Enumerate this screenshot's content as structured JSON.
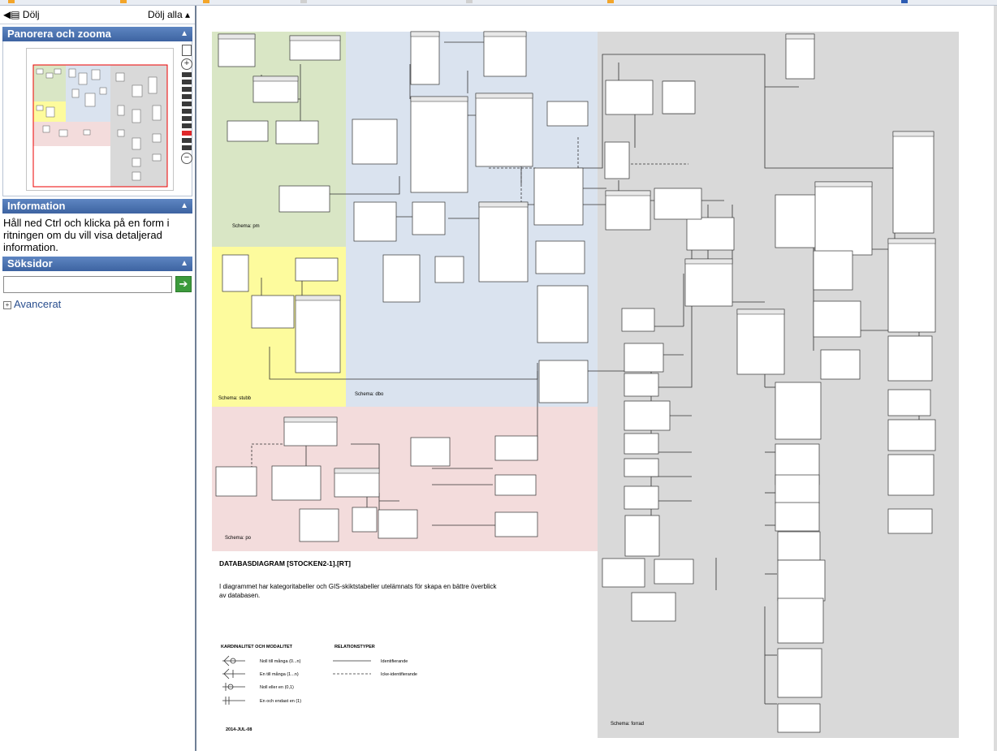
{
  "left_panel": {
    "hide_label": "Dölj",
    "hide_all_label": "Dölj alla",
    "panzoom_title": "Panorera och zooma",
    "info_title": "Information",
    "info_text": "Håll ned Ctrl och klicka på en form i ritningen om du vill visa detaljerad information.",
    "search_title": "Söksidor",
    "search_value": "",
    "advanced_label": "Avancerat"
  },
  "diagram": {
    "title": "DATABASDIAGRAM  [STOCKEN2-1].[RT]",
    "description": "I diagrammet har kategoritabeller och GIS-skiktstabeller utelämnats för skapa en bättre överblick av databasen.",
    "date": "2014-JUL-08",
    "legend": {
      "card_header": "KARDINALITET OCH MODALITET",
      "rel_header": "RELATIONSTYPER",
      "items": [
        "Noll till många  (0...n)",
        "En till många  (1...n)",
        "Noll eller en  (0,1)",
        "En och endast en  (1)"
      ],
      "rel_items": [
        "Identifierande",
        "Icke-identifierande"
      ]
    },
    "schemas": [
      "Schema: pm",
      "Schema: stubb",
      "Schema: dbo",
      "Schema: po",
      "Schema: forrad"
    ],
    "colors": {
      "pm": "#d9e6c5",
      "dbo": "#dae3ef",
      "stubb": "#fdfb9d",
      "po": "#f3dcdc",
      "forrad": "#d9d9d9"
    }
  }
}
